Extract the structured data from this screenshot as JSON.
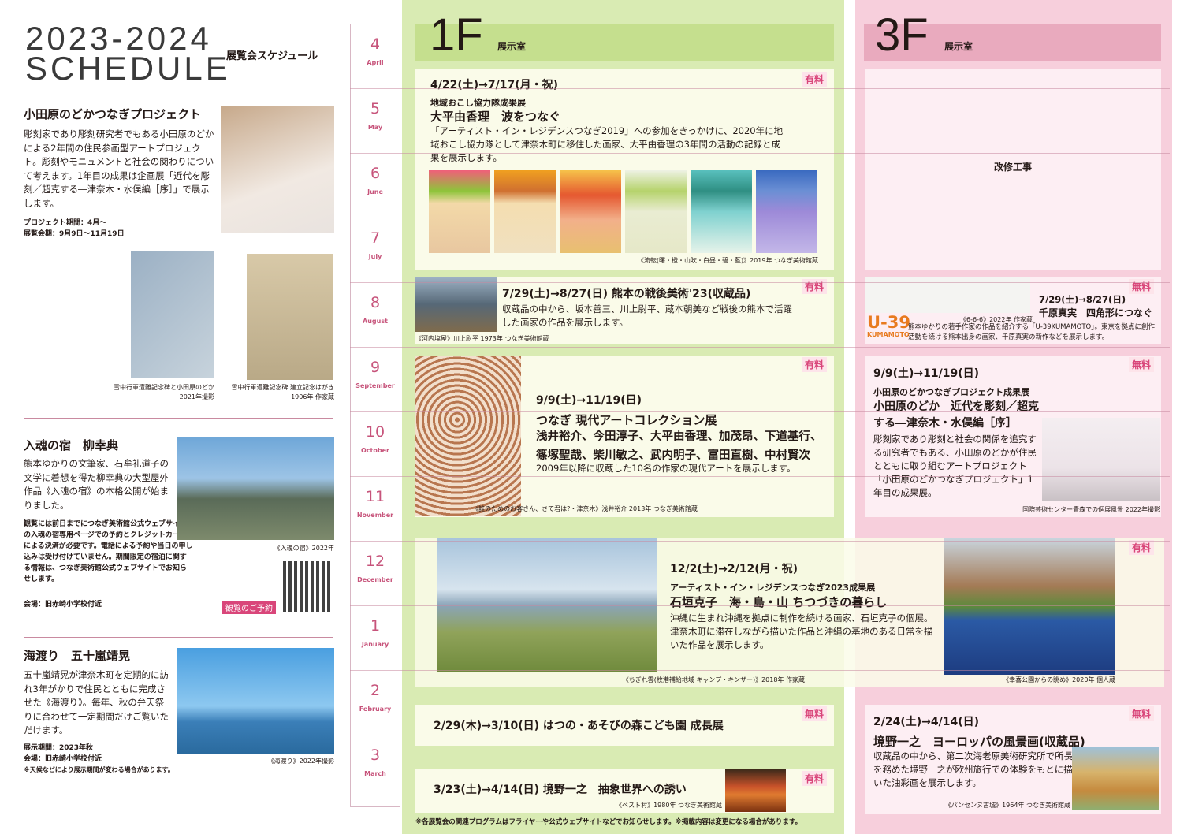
{
  "header": {
    "year": "2023-2024",
    "title": "SCHEDULE",
    "subtitle": "展覧会スケジュール"
  },
  "left": {
    "p1": {
      "title": "小田原のどかつなぎプロジェクト",
      "body": "彫刻家であり彫刻研究者でもある小田原のどかによる2年間の住民参画型アートプロジェクト。彫刻やモニュメントと社会の関わりについて考えます。1年目の成果は企画展「近代を彫刻／超克する―津奈木・水俣編［序］」で展示します。",
      "period": "プロジェクト期間：4月～",
      "exhibit": "展覧会期：9月9日～11月19日",
      "cap1": "雪中行軍遭難記念碑と小田原のどか\n2021年撮影",
      "cap2": "雪中行軍遭難記念碑 建立記念はがき\n1906年 作家蔵"
    },
    "p2": {
      "title": "入魂の宿　柳幸典",
      "body": "熊本ゆかりの文筆家、石牟礼道子の文学に着想を得た柳幸典の大型屋外作品《入魂の宿》の本格公開が始まりました。",
      "note": "観覧には前日までにつなぎ美術館公式ウェブサイトの入魂の宿専用ページでの予約とクレジットカードによる決済が必要です。電話による予約や当日の申し込みは受け付けていません。期間限定の宿泊に関する情報は、つなぎ美術館公式ウェブサイトでお知らせします。",
      "venue": "会場：旧赤崎小学校付近",
      "cap": "《入魂の宿》2022年",
      "reserve": "観覧のご予約"
    },
    "p3": {
      "title": "海渡り　五十嵐靖晃",
      "body": "五十嵐靖晃が津奈木町を定期的に訪れ3年がかりで住民とともに完成させた《海渡り》。毎年、秋の弁天祭りに合わせて一定期間だけご覧いただけます。",
      "period": "展示期間：2023年秋",
      "venue": "会場：旧赤崎小学校付近",
      "note": "※天候などにより展示期間が変わる場合があります。",
      "cap": "《海渡り》2022年撮影"
    }
  },
  "months": [
    {
      "n": "4",
      "e": "April"
    },
    {
      "n": "5",
      "e": "May"
    },
    {
      "n": "6",
      "e": "June"
    },
    {
      "n": "7",
      "e": "July"
    },
    {
      "n": "8",
      "e": "August"
    },
    {
      "n": "9",
      "e": "September"
    },
    {
      "n": "10",
      "e": "October"
    },
    {
      "n": "11",
      "e": "November"
    },
    {
      "n": "12",
      "e": "December"
    },
    {
      "n": "1",
      "e": "January"
    },
    {
      "n": "2",
      "e": "February"
    },
    {
      "n": "3",
      "e": "March"
    }
  ],
  "floor1": {
    "name": "1F",
    "label": "展示室"
  },
  "floor3": {
    "name": "3F",
    "label": "展示室"
  },
  "fee_paid": "有料",
  "fee_free": "無料",
  "e1": {
    "date": "4/22(土)→7/17(月・祝)",
    "t1": "地域おこし協力隊成果展",
    "t2": "大平由香理　波をつなぐ",
    "body": "「アーティスト・イン・レジデンスつなぎ2019」への参加をきっかけに、2020年に地域おこし協力隊として津奈木町に移住した画家、大平由香理の3年間の活動の記録と成果を展示します。",
    "cap": "《流転(曙・橙・山吹・白昼・碧・藍)》2019年 つなぎ美術館蔵"
  },
  "e2": {
    "date": "7/29(土)→8/27(日) 熊本の戦後美術'23(収蔵品)",
    "body": "収蔵品の中から、坂本善三、川上尉平、蔵本朝美など戦後の熊本で活躍した画家の作品を展示します。",
    "cap": "《河内塩屋》川上尉平 1973年 つなぎ美術館蔵"
  },
  "e3": {
    "date": "9/9(土)→11/19(日)",
    "t2": "つなぎ 現代アートコレクション展",
    "artists": "浅井裕介、今田淳子、大平由香理、加茂昂、下道基行、篠塚聖哉、柴川敏之、武内明子、富田直樹、中村賢次",
    "body": "2009年以降に収蔵した10名の作家の現代アートを展示します。",
    "cap": "《誰のためのお客さん、さて君は?・津奈木》浅井裕介 2013年 つなぎ美術館蔵"
  },
  "e4": {
    "date": "12/2(土)→2/12(月・祝)",
    "t1": "アーティスト・イン・レジデンスつなぎ2023成果展",
    "t2": "石垣克子　海・島・山 ちつづきの暮らし",
    "body": "沖縄に生まれ沖縄を拠点に制作を続ける画家、石垣克子の個展。津奈木町に滞在しながら描いた作品と沖縄の基地のある日常を描いた作品を展示します。",
    "cap1": "《ちぎれ雲(牧港補給地域 キャンプ・キンザー)》2018年 作家蔵",
    "cap2": "《幸喜公園からの眺め》2020年 個人蔵"
  },
  "e5": {
    "date": "2/29(木)→3/10(日) はつの・あそびの森こども園 成長展"
  },
  "e6": {
    "date": "3/23(土)→4/14(日) 境野一之　抽象世界への誘い",
    "cap": "《ベスト村》1980年 つなぎ美術館蔵"
  },
  "f3a": {
    "text": "改修工事"
  },
  "f3b": {
    "date": "7/29(土)→8/27(日)",
    "t2": "千原真実　四角形につなぐ",
    "logo": "U-39",
    "logo2": "KUMAMOTO",
    "capimg": "《6-6-6》2022年 作家蔵",
    "body": "熊本ゆかりの若手作家の作品を紹介する「U-39KUMAMOTO」。東京を拠点に創作活動を続ける熊本出身の画家、千原真実の新作などを展示します。"
  },
  "f3c": {
    "date": "9/9(土)→11/19(日)",
    "t1": "小田原のどかつなぎプロジェクト成果展",
    "t2": "小田原のどか　近代を彫刻／超克する―津奈木・水俣編［序］",
    "body": "彫刻家であり彫刻と社会の関係を追究する研究者でもある、小田原のどかが住民とともに取り組むアートプロジェクト「小田原のどかつなぎプロジェクト」1年目の成果展。",
    "cap": "国際芸術センター青森での個展風景 2022年撮影"
  },
  "f3d": {
    "date": "2/24(土)→4/14(日)",
    "t2": "境野一之　ヨーロッパの風景画(収蔵品)",
    "body": "収蔵品の中から、第二次海老原美術研究所で所長を務めた境野一之が欧州旅行での体験をもとに描いた油彩画を展示します。",
    "cap": "《パンセンヌ古城》1964年 つなぎ美術館蔵"
  },
  "footnote": "※各展覧会の関連プログラムはフライヤーや公式ウェブサイトなどでお知らせします。※掲載内容は変更になる場合があります。"
}
